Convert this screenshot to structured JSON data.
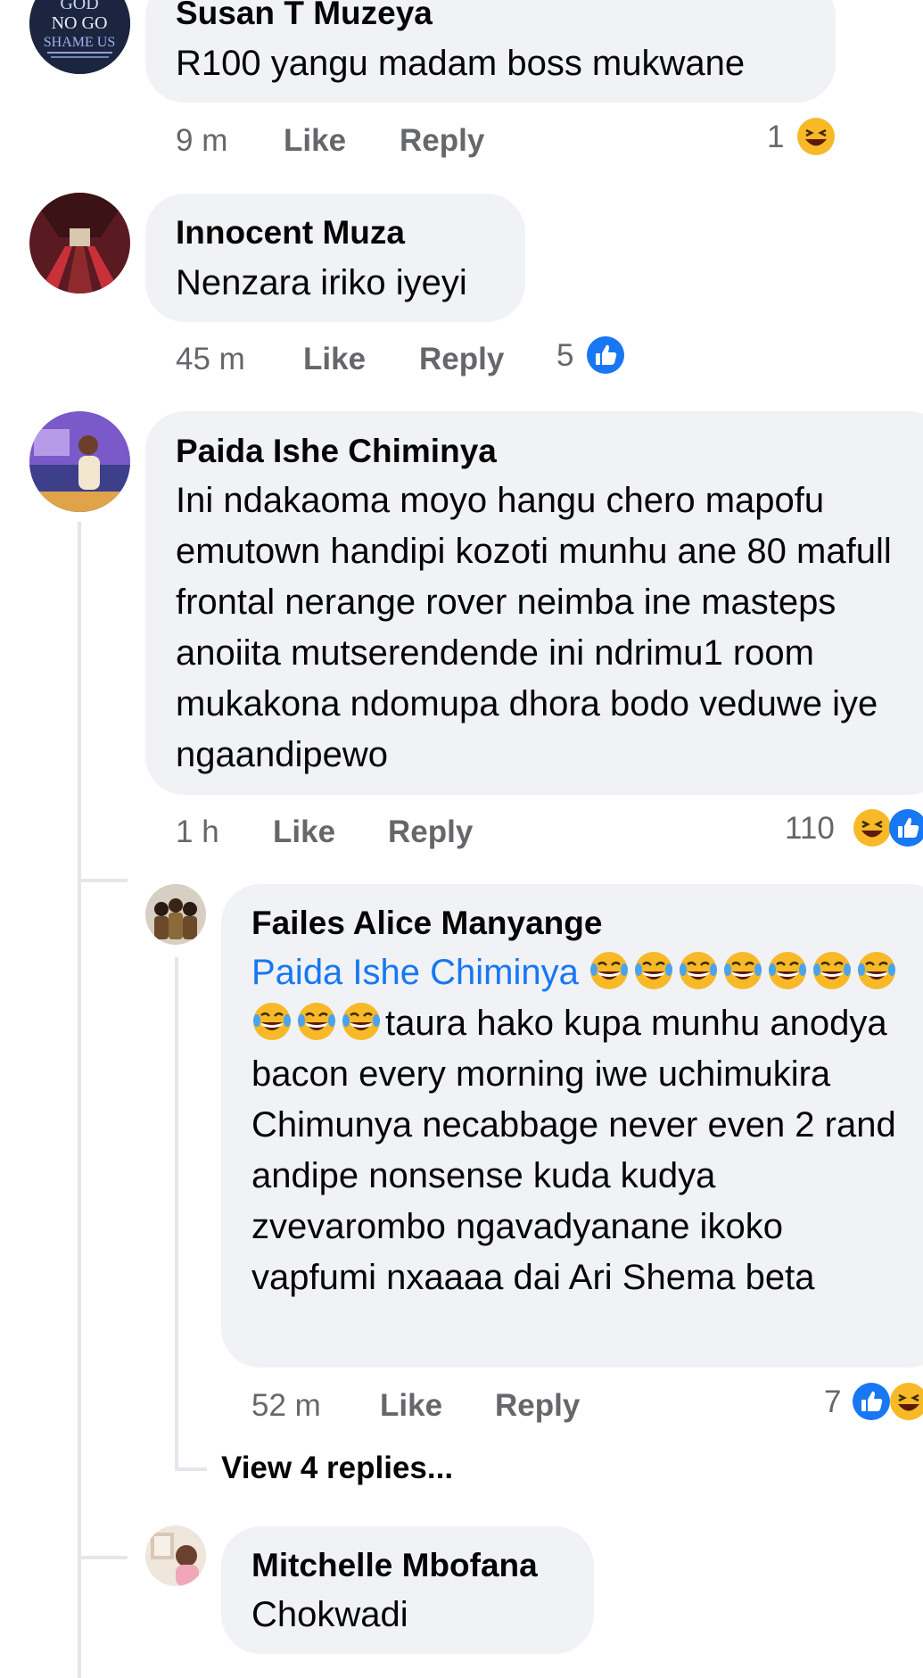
{
  "comments": [
    {
      "author": "Susan T Muzeya",
      "text": "R100 yangu madam boss mukwane",
      "time": "9 m",
      "like_label": "Like",
      "reply_label": "Reply",
      "reaction_count": "1",
      "reactions": [
        "laugh-reaction"
      ]
    },
    {
      "author": "Innocent Muza",
      "text": "Nenzara iriko iyeyi",
      "time": "45 m",
      "like_label": "Like",
      "reply_label": "Reply",
      "reaction_count": "5",
      "reactions": [
        "like-reaction"
      ]
    },
    {
      "author": "Paida Ishe Chiminya",
      "text": "Ini ndakaoma moyo hangu chero mapofu emutown handipi kozoti munhu ane 80 mafull frontal nerange rover neimba ine masteps anoiita mutserendende ini ndrimu1 room mukakona ndomupa dhora bodo veduwe iye ngaandipewo",
      "time": "1 h",
      "like_label": "Like",
      "reply_label": "Reply",
      "reaction_count": "110",
      "reactions": [
        "laugh-reaction",
        "like-reaction"
      ],
      "replies": [
        {
          "author": "Failes Alice Manyange",
          "mention": "Paida Ishe Chiminya",
          "text": "taura hako kupa munhu anodya bacon every morning iwe uchimukira Chimunya necabbage never even 2 rand andipe nonsense kuda kudya zvevarombo ngavadyanane ikoko vapfumi nxaaaa dai Ari Shema beta",
          "time": "52 m",
          "like_label": "Like",
          "reply_label": "Reply",
          "reaction_count": "7",
          "reactions": [
            "like-reaction",
            "laugh-reaction"
          ]
        },
        {
          "author": "Mitchelle Mbofana",
          "text": "Chokwadi"
        }
      ],
      "view_more_replies": "View 4 replies..."
    }
  ],
  "avatar_text": {
    "line1": "GOD",
    "line2": "NO GO",
    "line3": "SHAME US"
  },
  "colors": {
    "bubble": "#f0f2f5",
    "meta": "#65676b",
    "mention": "#1877f2",
    "like_blue": "#1877f2",
    "laugh_yellow": "#f7b928"
  }
}
